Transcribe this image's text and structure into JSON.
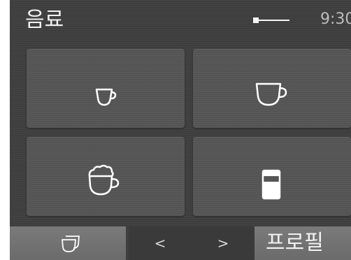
{
  "header": {
    "title": "음료",
    "time": "9:30",
    "indicator_icon": "slider-indicator-icon"
  },
  "drinks": [
    {
      "name": "espresso",
      "icon": "espresso-cup-icon"
    },
    {
      "name": "coffee",
      "icon": "coffee-cup-icon"
    },
    {
      "name": "cappuccino",
      "icon": "cappuccino-cup-icon"
    },
    {
      "name": "latte-macchiato",
      "icon": "latte-glass-icon"
    }
  ],
  "footer": {
    "cups_icon": "two-cups-icon",
    "prev_label": "<",
    "next_label": ">",
    "profile_label": "프로필"
  },
  "colors": {
    "background": "#3f3f3f",
    "tile": "#565656",
    "button": "#737373",
    "text": "#f2f2f2"
  }
}
